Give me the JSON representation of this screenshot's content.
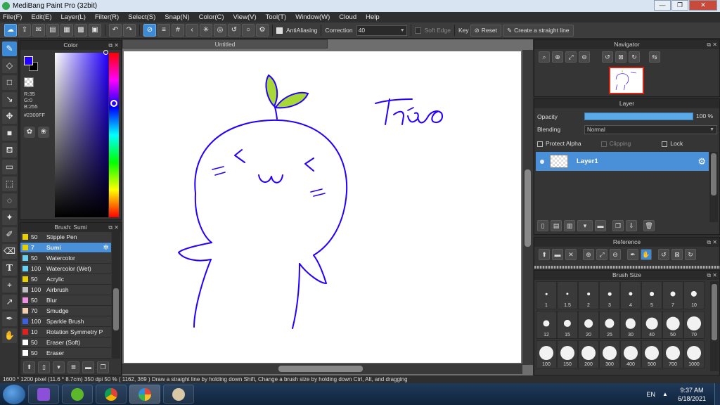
{
  "window": {
    "title": "MediBang Paint Pro (32bit)",
    "min": "—",
    "max": "❐",
    "close": "✕"
  },
  "menu": [
    "File(F)",
    "Edit(E)",
    "Layer(L)",
    "Filter(R)",
    "Select(S)",
    "Snap(N)",
    "Color(C)",
    "View(V)",
    "Tool(T)",
    "Window(W)",
    "Cloud",
    "Help"
  ],
  "toolbar": {
    "antialiasing_label": "AntiAliasing",
    "correction_label": "Correction",
    "correction_value": "40",
    "soft_edge_label": "Soft Edge",
    "key_label": "Key",
    "reset_label": "Reset",
    "straight_line_label": "Create a straight line"
  },
  "color_panel": {
    "title": "Color",
    "r": "R:35",
    "g": "G:0",
    "b": "B:255",
    "hex": "#2300FF",
    "fg_color": "#2300ff"
  },
  "brush_panel": {
    "title": "Brush: Sumi",
    "items": [
      {
        "size": "50",
        "name": "Stipple Pen",
        "color": "#e8d000"
      },
      {
        "size": "7",
        "name": "Sumi",
        "color": "#e8d000",
        "selected": true
      },
      {
        "size": "50",
        "name": "Watercolor",
        "color": "#68d0f0"
      },
      {
        "size": "100",
        "name": "Watercolor (Wet)",
        "color": "#68d0f0"
      },
      {
        "size": "50",
        "name": "Acrylic",
        "color": "#e8d000"
      },
      {
        "size": "100",
        "name": "Airbrush",
        "color": "#c0c0c0"
      },
      {
        "size": "50",
        "name": "Blur",
        "color": "#f090e0"
      },
      {
        "size": "70",
        "name": "Smudge",
        "color": "#f0d0b0"
      },
      {
        "size": "100",
        "name": "Sparkle Brush",
        "color": "#3c60e0"
      },
      {
        "size": "10",
        "name": "Rotation Symmetry P",
        "color": "#e02020"
      },
      {
        "size": "50",
        "name": "Eraser (Soft)",
        "color": "#ffffff"
      },
      {
        "size": "50",
        "name": "Eraser",
        "color": "#ffffff"
      }
    ]
  },
  "canvas": {
    "tab": "Untitled",
    "signature": "Thảo",
    "stroke_color": "#2300ff",
    "sprout_color": "#a8d838"
  },
  "navigator": {
    "title": "Navigator"
  },
  "layer_panel": {
    "title": "Layer",
    "opacity_label": "Opacity",
    "opacity_value": "100 %",
    "opacity_fraction": 1.0,
    "blending_label": "Blending",
    "blending_value": "Normal",
    "protect_alpha": "Protect Alpha",
    "clipping": "Clipping",
    "lock": "Lock",
    "layer_name": "Layer1"
  },
  "reference": {
    "title": "Reference"
  },
  "brush_size": {
    "title": "Brush Size",
    "sizes": [
      "1",
      "1.5",
      "2",
      "3",
      "4",
      "5",
      "7",
      "10",
      "12",
      "15",
      "20",
      "25",
      "30",
      "40",
      "50",
      "70",
      "100",
      "150",
      "200",
      "300",
      "400",
      "500",
      "700",
      "1000"
    ]
  },
  "status": {
    "text": "1600 * 1200 pixel   (11.6 * 8.7cm)   350 dpi   50 %   ( 1162, 369 )   Draw a straight line by holding down Shift, Change a brush size by holding down Ctrl, Alt, and dragging"
  },
  "taskbar": {
    "lang": "EN",
    "time": "9:37 AM",
    "date": "6/18/2021"
  }
}
